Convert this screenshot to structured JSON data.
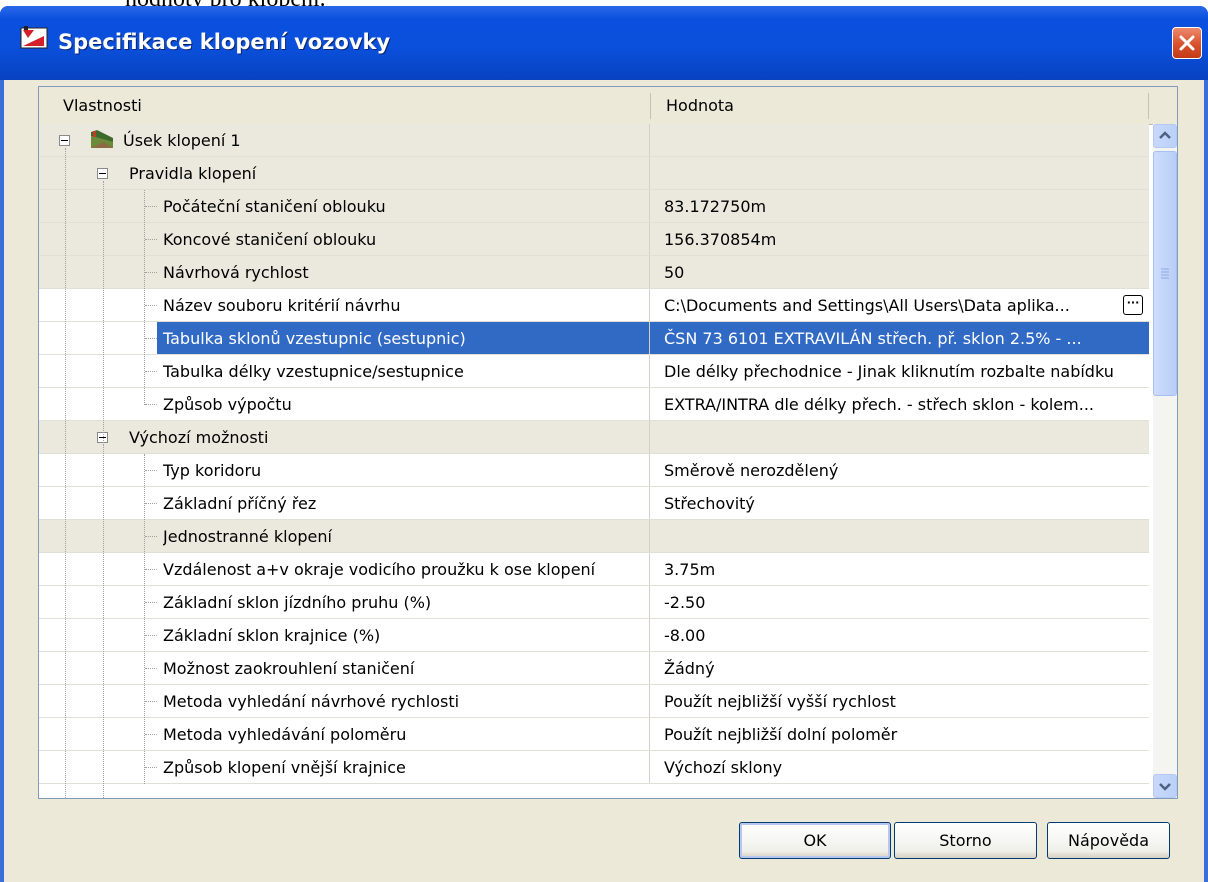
{
  "document": {
    "fragment_text": "hodnoty pro klopení."
  },
  "window": {
    "title": "Specifikace klopení vozovky",
    "accent_color": "#0a50dc"
  },
  "grid": {
    "columns": {
      "property": "Vlastnosti",
      "value": "Hodnota"
    },
    "rows": [
      {
        "label": "Úsek klopení 1",
        "value": "",
        "level": 0,
        "type": "root",
        "shaded": true
      },
      {
        "label": "Pravidla klopení",
        "value": "",
        "level": 1,
        "type": "group",
        "shaded": true
      },
      {
        "label": "Počáteční staničení oblouku",
        "value": "83.172750m",
        "level": 2,
        "shaded": true
      },
      {
        "label": "Koncové staničení oblouku",
        "value": "156.370854m",
        "level": 2,
        "shaded": true
      },
      {
        "label": "Návrhová rychlost",
        "value": "50",
        "level": 2,
        "shaded": true
      },
      {
        "label": "Název souboru kritérií návrhu",
        "value": "C:\\Documents and Settings\\All Users\\Data aplika...",
        "level": 2,
        "shaded": false,
        "has_browse": true
      },
      {
        "label": "Tabulka sklonů vzestupnic (sestupnic)",
        "value": "ČSN 73 6101 EXTRAVILÁN střech. př. sklon 2.5% - ...",
        "level": 2,
        "shaded": false,
        "selected": true
      },
      {
        "label": "Tabulka délky vzestupnice/sestupnice",
        "value": "Dle délky přechodnice - Jinak kliknutím rozbalte nabídku",
        "level": 2,
        "shaded": false
      },
      {
        "label": "Způsob výpočtu",
        "value": "EXTRA/INTRA dle délky přech. - střech sklon - kolem...",
        "level": 2,
        "shaded": false
      },
      {
        "label": "Výchozí možnosti",
        "value": "",
        "level": 1,
        "type": "group",
        "shaded": true
      },
      {
        "label": "Typ koridoru",
        "value": "Směrově nerozdělený",
        "level": 2,
        "shaded": false
      },
      {
        "label": "Základní příčný řez",
        "value": "Střechovitý",
        "level": 2,
        "shaded": false
      },
      {
        "label": "Jednostranné klopení",
        "value": "",
        "level": 2,
        "shaded": true
      },
      {
        "label": "Vzdálenost a+v okraje vodicího proužku k ose klopení",
        "value": "3.75m",
        "level": 2,
        "shaded": false
      },
      {
        "label": "Základní sklon jízdního pruhu (%)",
        "value": "-2.50",
        "level": 2,
        "shaded": false
      },
      {
        "label": "Základní sklon krajnice (%)",
        "value": "-8.00",
        "level": 2,
        "shaded": false
      },
      {
        "label": "Možnost zaokrouhlení staničení",
        "value": "Žádný",
        "level": 2,
        "shaded": false
      },
      {
        "label": "Metoda vyhledání návrhové rychlosti",
        "value": "Použít nejbližší vyšší rychlost",
        "level": 2,
        "shaded": false
      },
      {
        "label": "Metoda vyhledávání poloměru",
        "value": "Použít nejbližší dolní poloměr",
        "level": 2,
        "shaded": false
      },
      {
        "label": "Způsob klopení vnější krajnice",
        "value": "Výchozí sklony",
        "level": 2,
        "shaded": false
      }
    ],
    "colors": {
      "selected": "#316ac5",
      "shaded": "#ebe9de",
      "plain": "#ffffff"
    }
  },
  "buttons": {
    "ok": "OK",
    "cancel": "Storno",
    "help": "Nápověda"
  }
}
